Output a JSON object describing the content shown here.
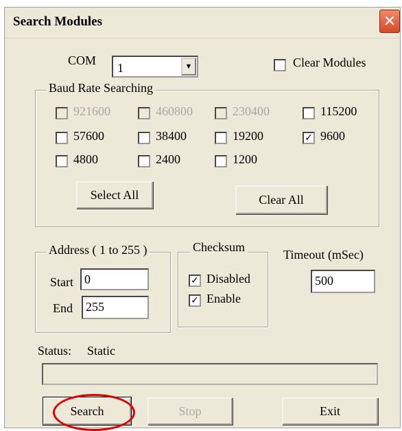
{
  "window": {
    "title": "Search Modules",
    "close_glyph": "✕"
  },
  "com": {
    "label": "COM",
    "value": "1",
    "arrow_glyph": "▼"
  },
  "clear_modules": {
    "label": "Clear Modules",
    "checked": false
  },
  "baud_group": {
    "title": "Baud Rate Searching",
    "rates": [
      {
        "label": "921600",
        "checked": false,
        "enabled": false
      },
      {
        "label": "460800",
        "checked": false,
        "enabled": false
      },
      {
        "label": "230400",
        "checked": false,
        "enabled": false
      },
      {
        "label": "115200",
        "checked": false,
        "enabled": true
      },
      {
        "label": "57600",
        "checked": false,
        "enabled": true
      },
      {
        "label": "38400",
        "checked": false,
        "enabled": true
      },
      {
        "label": "19200",
        "checked": false,
        "enabled": true
      },
      {
        "label": "9600",
        "checked": true,
        "enabled": true
      },
      {
        "label": "4800",
        "checked": false,
        "enabled": true
      },
      {
        "label": "2400",
        "checked": false,
        "enabled": true
      },
      {
        "label": "1200",
        "checked": false,
        "enabled": true
      }
    ],
    "select_all_label": "Select All",
    "clear_all_label": "Clear All"
  },
  "address_group": {
    "title": "Address ( 1 to 255 )",
    "start_label": "Start",
    "start_value": "0",
    "end_label": "End",
    "end_value": "255"
  },
  "checksum_group": {
    "title": "Checksum",
    "disabled_label": "Disabled",
    "disabled_checked": true,
    "enabled_label": "Enable",
    "enabled_checked": true
  },
  "timeout": {
    "label": "Timeout (mSec)",
    "value": "500"
  },
  "status": {
    "label": "Status:",
    "value": "Static"
  },
  "buttons": {
    "search": "Search",
    "stop": "Stop",
    "exit": "Exit"
  },
  "check_glyph": "✓"
}
